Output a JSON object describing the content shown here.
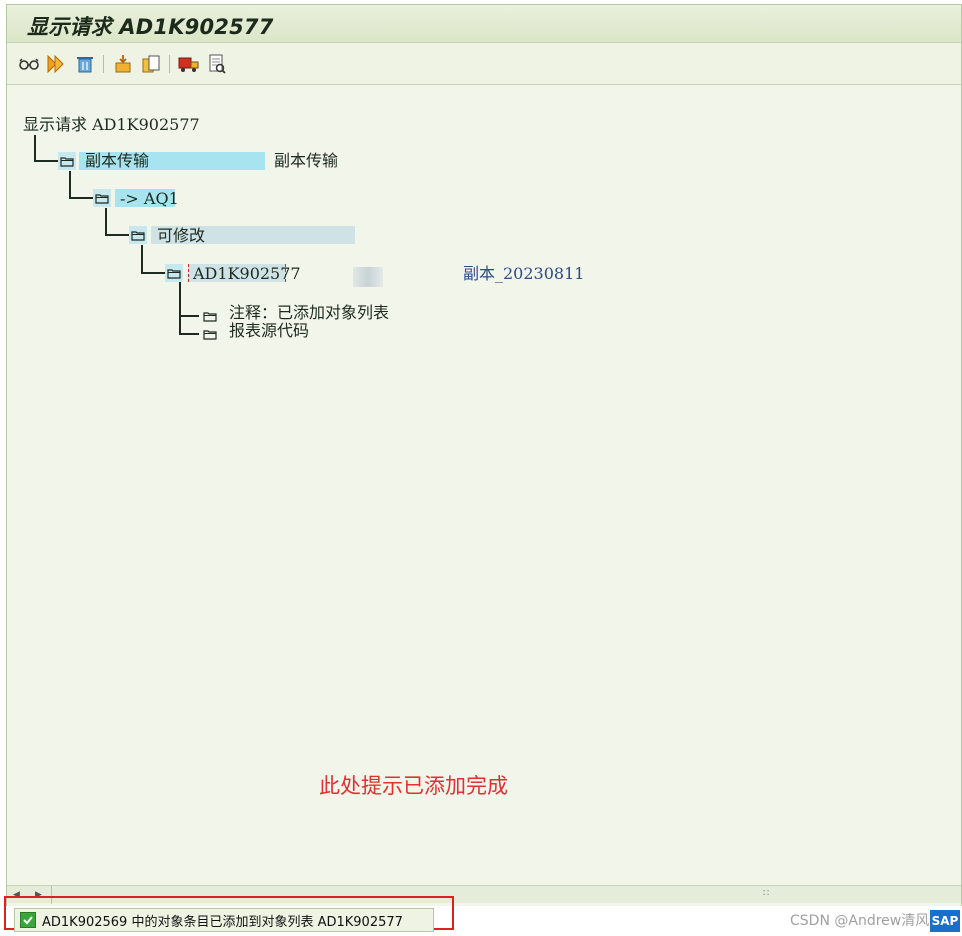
{
  "window": {
    "title": "显示请求 AD1K902577"
  },
  "toolbar": {
    "icons": [
      "glasses-icon",
      "execute-icon",
      "delete-icon",
      "object-list-icon",
      "copy-doc-icon",
      "transport-truck-icon",
      "print-preview-icon"
    ]
  },
  "tree": {
    "root": "显示请求 AD1K902577",
    "node1": {
      "label": "副本传输",
      "desc": "副本传输"
    },
    "node2": {
      "label": "-> AQ1"
    },
    "node3": {
      "label": "可修改"
    },
    "node4": {
      "label": "AD1K902577",
      "desc": "副本_20230811"
    },
    "node5": {
      "label": "注释：已添加对象列表"
    },
    "node6": {
      "label": "报表源代码"
    }
  },
  "annotation": {
    "text": "此处提示已添加完成"
  },
  "status": {
    "message": "AD1K902569 中的对象条目已添加到对象列表 AD1K902577"
  },
  "watermark": {
    "text": "CSDN @Andrew清风"
  },
  "logo": {
    "text": "SAP"
  },
  "colors": {
    "highlight": "#a7e4f0",
    "muted_highlight": "#cfe3e6",
    "accent_red": "#e03030",
    "success_green": "#3aa63a"
  }
}
